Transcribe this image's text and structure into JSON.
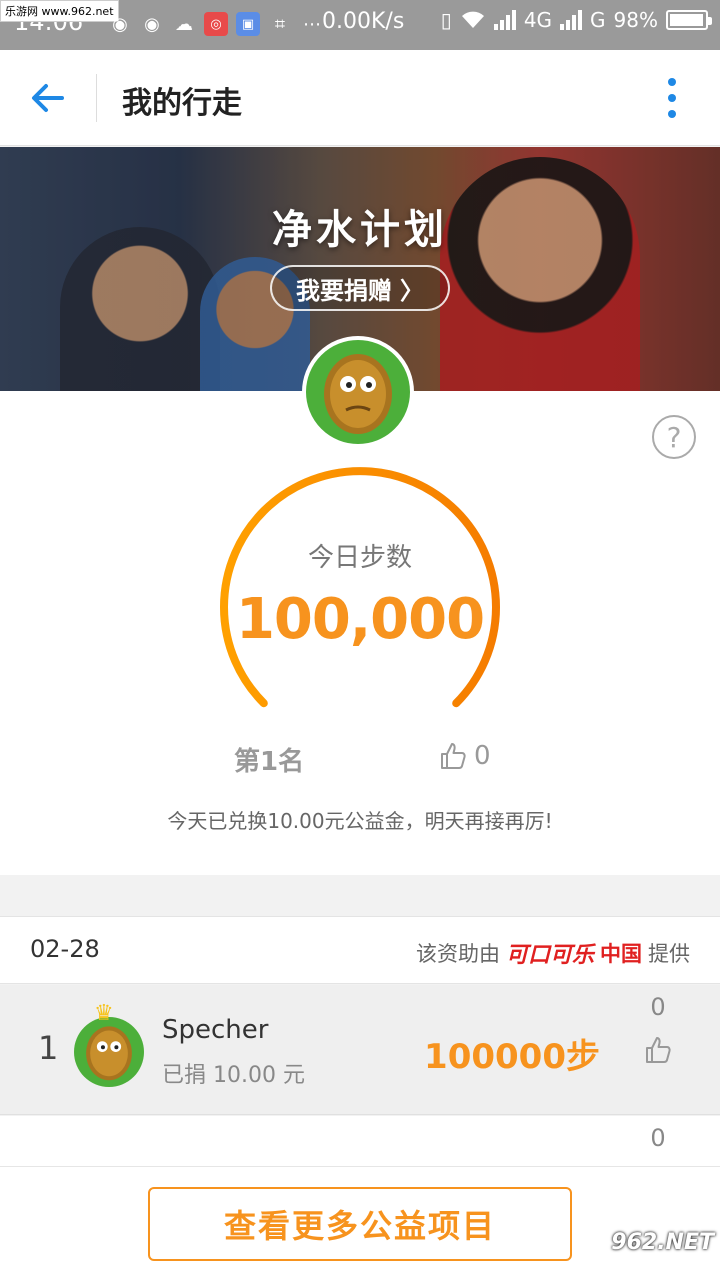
{
  "status_bar": {
    "time": "14:06",
    "watermark": "乐游网 www.962.net",
    "network_speed": "0.00K/s",
    "signal_1": "4G",
    "signal_2": "G",
    "battery_percent": "98%",
    "battery_level": 0.98
  },
  "appbar": {
    "title": "我的行走"
  },
  "banner": {
    "title": "净水计划",
    "donate_label": "我要捐赠",
    "donate_chevron": "〉"
  },
  "stats": {
    "help_symbol": "?",
    "label": "今日步数",
    "steps": "100,000",
    "progress": 1.0,
    "rank": "第1名",
    "likes": "0",
    "message": "今天已兑换10.00元公益金，明天再接再厉!"
  },
  "list": {
    "date": "02-28",
    "sponsor_prefix": "该资助由",
    "sponsor_brand": "可口可乐",
    "sponsor_region": "中国",
    "sponsor_suffix": "提供",
    "rows": [
      {
        "rank": "1",
        "name": "Specher",
        "donated": "已捐 10.00 元",
        "steps": "100000步",
        "likes": "0"
      },
      {
        "rank": "",
        "name": "",
        "donated": "",
        "steps": "",
        "likes": "0"
      }
    ]
  },
  "bottom": {
    "more_label": "查看更多公益项目"
  },
  "watermark_br": "962.NET",
  "colors": {
    "accent_orange": "#f7931e",
    "accent_blue": "#1e88e5",
    "avatar_green": "#4caf3a"
  }
}
